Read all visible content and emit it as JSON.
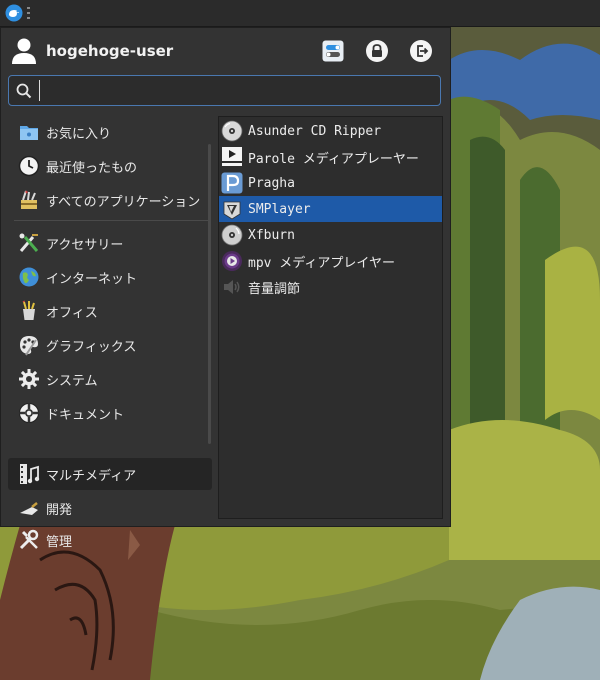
{
  "user": {
    "name": "hogehoge-user"
  },
  "search": {
    "value": "",
    "placeholder": ""
  },
  "categories": [
    {
      "label": "お気に入り",
      "icon": "favorites-folder-icon"
    },
    {
      "label": "最近使ったもの",
      "icon": "clock-icon"
    },
    {
      "label": "すべてのアプリケーション",
      "icon": "all-apps-icon"
    },
    {
      "label": "アクセサリー",
      "icon": "accessories-icon"
    },
    {
      "label": "インターネット",
      "icon": "globe-icon"
    },
    {
      "label": "オフィス",
      "icon": "office-icon"
    },
    {
      "label": "グラフィックス",
      "icon": "palette-icon"
    },
    {
      "label": "システム",
      "icon": "gear-icon"
    },
    {
      "label": "ドキュメント",
      "icon": "help-lifebuoy-icon"
    },
    {
      "label": "マルチメディア",
      "icon": "film-music-icon"
    },
    {
      "label": "開発",
      "icon": "trowel-icon"
    },
    {
      "label": "管理",
      "icon": "wrench-screwdriver-icon"
    }
  ],
  "active_category": "マルチメディア",
  "apps": [
    {
      "label": "Asunder CD Ripper",
      "icon": "cd-icon"
    },
    {
      "label": "Parole メディアプレーヤー",
      "icon": "parole-play-icon"
    },
    {
      "label": "Pragha",
      "icon": "pragha-icon"
    },
    {
      "label": "SMPlayer",
      "icon": "smplayer-icon"
    },
    {
      "label": "Xfburn",
      "icon": "disc-burn-icon"
    },
    {
      "label": "mpv メディアプレイヤー",
      "icon": "mpv-icon"
    },
    {
      "label": "音量調節",
      "icon": "speaker-icon"
    }
  ],
  "selected_app": "SMPlayer",
  "colors": {
    "selection": "#1e5aa8",
    "search_border": "#4a78b0",
    "menu_bg": "#333333"
  }
}
